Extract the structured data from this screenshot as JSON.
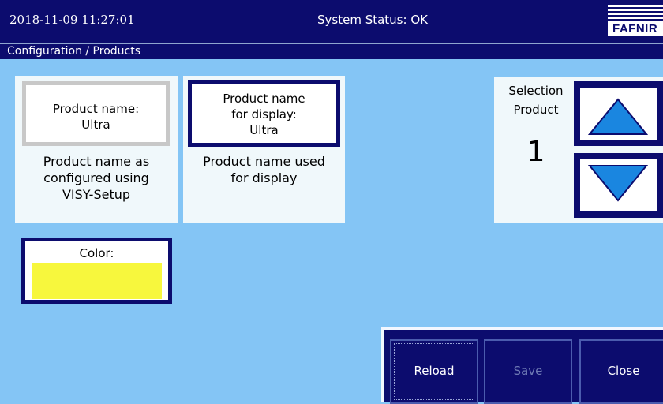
{
  "header": {
    "datetime": "2018-11-09  11:27:01",
    "status": "System Status: OK",
    "logo_text": "FAFNIR"
  },
  "breadcrumb": "Configuration / Products",
  "product_name": {
    "label": "Product name:",
    "value": "Ultra",
    "description_lines": [
      "Product name as",
      "configured using",
      "VISY-Setup"
    ]
  },
  "display_name": {
    "label_lines": [
      "Product name",
      "for display:"
    ],
    "value": "Ultra",
    "description_lines": [
      "Product name used",
      "for display"
    ]
  },
  "selection": {
    "title_lines": [
      "Selection",
      "Product"
    ],
    "number": "1",
    "up_icon": "triangle-up-icon",
    "down_icon": "triangle-down-icon"
  },
  "color": {
    "label": "Color:",
    "value": "#f7f73d"
  },
  "buttons": {
    "reload": "Reload",
    "save": "Save",
    "close": "Close"
  },
  "colors": {
    "background": "#84c5f5",
    "bar": "#0c0c6e",
    "arrow": "#1a86e0"
  }
}
